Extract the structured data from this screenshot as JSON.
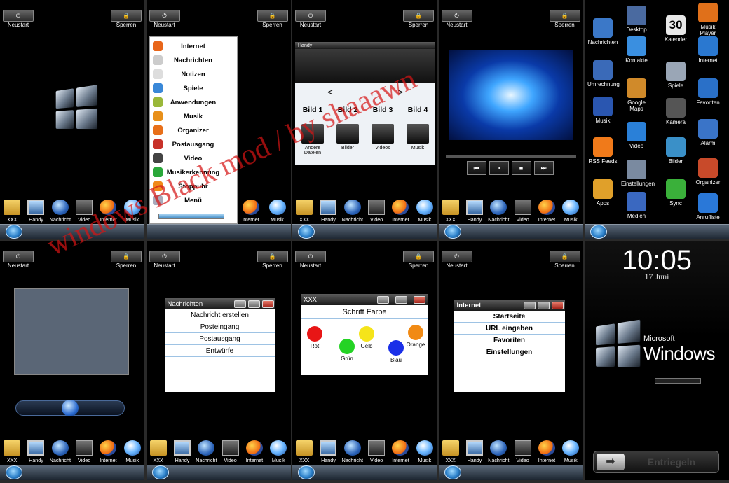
{
  "top": {
    "neustart": "Neustart",
    "sperren": "Sperren"
  },
  "dock": [
    "XXX",
    "Handy",
    "Nachricht",
    "Video",
    "Internet",
    "Musik"
  ],
  "dock_partial": [
    "Internet",
    "Musik"
  ],
  "start_menu": [
    "Internet",
    "Nachrichten",
    "Notizen",
    "Spiele",
    "Anwendungen",
    "Musik",
    "Organizer",
    "Postausgang",
    "Video",
    "Musikerkennung",
    "Stoppuhr",
    "Menü"
  ],
  "explorer": {
    "title": "Handy",
    "nav_prev": "<",
    "nav_next": ">",
    "tabs": [
      "Bild 1",
      "Bild 2",
      "Bild 3",
      "Bild 4"
    ],
    "folders": [
      "Andere Dateien",
      "Bilder",
      "Videos",
      "Musik"
    ]
  },
  "player": {
    "controls": [
      "prev",
      "pause",
      "stop",
      "next"
    ]
  },
  "apps": [
    {
      "label": "Nachrichten",
      "color": "#3b78c8"
    },
    {
      "label": "Desktop",
      "color": "#4a6aa0"
    },
    {
      "label": "Kalender",
      "value": "30",
      "color": "#e8e8e8"
    },
    {
      "label": "Musik Player",
      "color": "#e0701a"
    },
    {
      "label": "Kontakte",
      "color": "#3a8fe0"
    },
    {
      "label": "Internet",
      "color": "#2a78d0"
    },
    {
      "label": "Umrechnung",
      "color": "#3a6ab8"
    },
    {
      "label": "Spiele",
      "color": "#9aa6b6"
    },
    {
      "label": "Favoriten",
      "color": "#2a70c8"
    },
    {
      "label": "Google Maps",
      "color": "#d08a2a"
    },
    {
      "label": "Musik",
      "color": "#2a56b0"
    },
    {
      "label": "Kamera",
      "color": "#555"
    },
    {
      "label": "Alarm",
      "color": "#3a74c8"
    },
    {
      "label": "Video",
      "color": "#2a80d8"
    },
    {
      "label": "RSS Feeds",
      "color": "#f07a1a"
    },
    {
      "label": "Bilder",
      "color": "#3a90c8"
    },
    {
      "label": "Organizer",
      "color": "#c84a2a"
    },
    {
      "label": "Einstellungen",
      "color": "#7a8aa0"
    },
    {
      "label": "Apps",
      "color": "#e0a02a"
    },
    {
      "label": "Sync",
      "color": "#3ab03a"
    },
    {
      "label": "Anrufliste",
      "color": "#2a78d8"
    },
    {
      "label": "Medien",
      "color": "#3a68c0"
    }
  ],
  "nachrichten": {
    "title": "Nachrichten",
    "items": [
      "Nachricht erstellen",
      "Posteingang",
      "Postausgang",
      "Entwürfe"
    ]
  },
  "schrift": {
    "title": "XXX",
    "header": "Schrift Farbe",
    "colors": [
      {
        "label": "Rot",
        "color": "#e81616"
      },
      {
        "label": "Grün",
        "color": "#24d324"
      },
      {
        "label": "Gelb",
        "color": "#f5e41a"
      },
      {
        "label": "Blau",
        "color": "#1a2fe8"
      },
      {
        "label": "Orange",
        "color": "#f18a14"
      }
    ]
  },
  "internet": {
    "title": "Internet",
    "items": [
      "Startseite",
      "URL eingeben",
      "Favoriten",
      "Einstellungen"
    ]
  },
  "lock": {
    "time": "10:05",
    "date": "17 Juni",
    "brand_top": "Microsoft",
    "brand": "Windows",
    "unlock": "Entriegeln"
  },
  "watermark": "windows Black mod / by shaaawn"
}
